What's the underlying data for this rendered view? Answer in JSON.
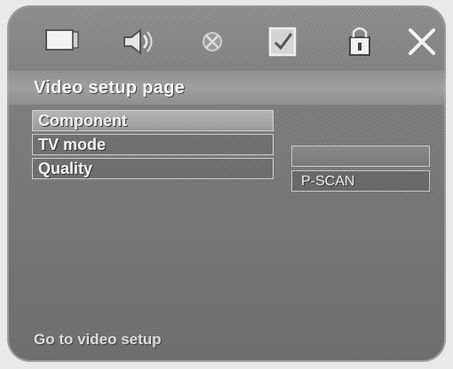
{
  "toolbar": {
    "icons": [
      {
        "name": "general-setup-icon"
      },
      {
        "name": "audio-setup-icon"
      },
      {
        "name": "dolby-setup-icon"
      },
      {
        "name": "video-setup-icon"
      },
      {
        "name": "preference-lock-icon"
      },
      {
        "name": "exit-icon"
      }
    ]
  },
  "page": {
    "title": "Video setup page"
  },
  "menu": {
    "items": [
      {
        "label": "Component"
      },
      {
        "label": "TV mode"
      },
      {
        "label": "Quality"
      }
    ]
  },
  "submenu": {
    "options": [
      {
        "label": ""
      },
      {
        "label": "P-SCAN"
      }
    ]
  },
  "footer": {
    "hint": "Go to video setup"
  }
}
